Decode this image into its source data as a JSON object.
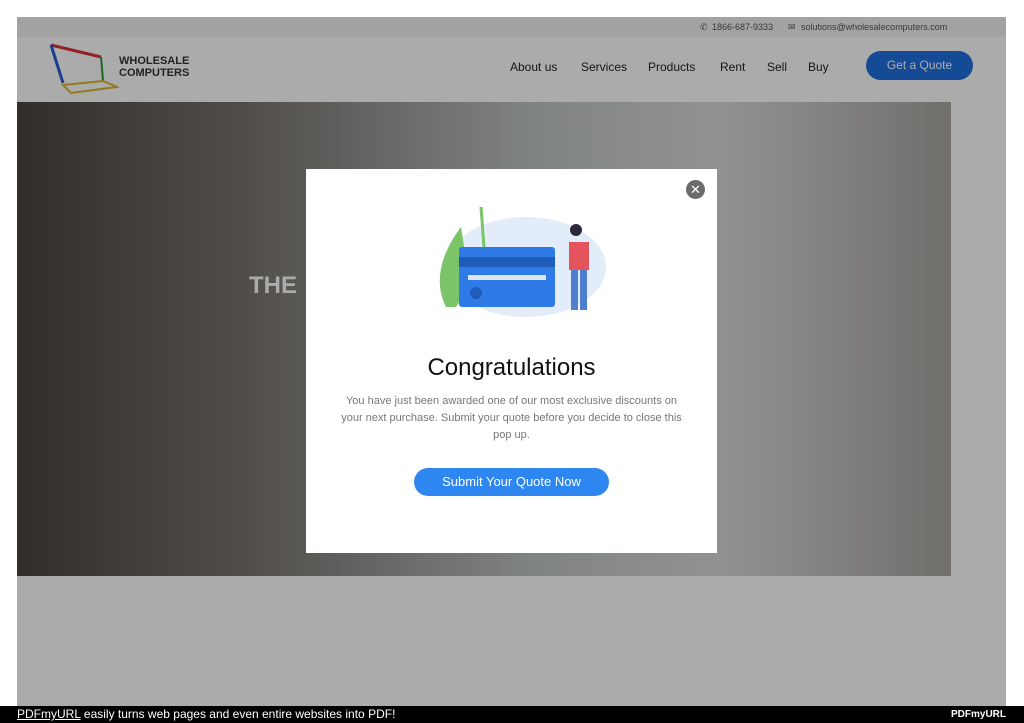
{
  "topbar": {
    "phone": "1866-687-9333",
    "email": "solutions@wholesalecomputers.com"
  },
  "header": {
    "logo_line1": "WHOLESALE",
    "logo_line2": "COMPUTERS",
    "nav": [
      "About us",
      "Services",
      "Products",
      "Rent",
      "Sell",
      "Buy"
    ],
    "quote_button": "Get a Quote"
  },
  "hero": {
    "title_visible": "THE"
  },
  "modal": {
    "title": "Congratulations",
    "body": "You have just been awarded one of our most exclusive discounts on your next purchase. Submit your quote before you decide to close this pop up.",
    "cta": "Submit Your Quote Now",
    "close": "✕"
  },
  "footer": {
    "link": "PDFmyURL",
    "text": " easily turns web pages and even entire websites into PDF!",
    "logo": "PDFmyURL"
  },
  "colors": {
    "accent": "#2e86f0",
    "overlay": "rgba(0,0,0,0.33)"
  }
}
